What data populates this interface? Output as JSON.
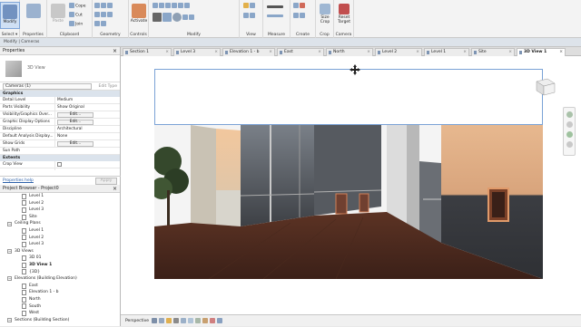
{
  "ribbon": {
    "groups": [
      {
        "label": "Select ▾"
      },
      {
        "label": "Properties"
      },
      {
        "label": "Clipboard"
      },
      {
        "label": "Geometry"
      },
      {
        "label": "Controls"
      },
      {
        "label": "Modify"
      },
      {
        "label": "View"
      },
      {
        "label": "Measure"
      },
      {
        "label": "Create"
      },
      {
        "label": "Crop"
      },
      {
        "label": "Camera"
      }
    ],
    "modify_label": "Modify",
    "paste_label": "Paste",
    "cope_label": "Cope",
    "cut_label": "Cut",
    "join_label": "Join",
    "activate_label": "Activate",
    "size_crop_label": "Size Crop",
    "reset_target_label": "Reset Target"
  },
  "context_bar": {
    "text": "Modify | Cameras"
  },
  "properties": {
    "title": "Properties",
    "type_name": "3D View",
    "filter_value": "Cameras (1)",
    "edit_type_label": "Edit Type",
    "categories": [
      {
        "name": "Graphics",
        "rows": [
          {
            "key": "Detail Level",
            "value": "Medium"
          },
          {
            "key": "Parts Visibility",
            "value": "Show Original"
          },
          {
            "key": "Visibility/Graphics Over...",
            "value": "Edit...",
            "button": true
          },
          {
            "key": "Graphic Display Options",
            "value": "Edit...",
            "button": true
          },
          {
            "key": "Discipline",
            "value": "Architectural"
          },
          {
            "key": "Default Analysis Display...",
            "value": "None"
          },
          {
            "key": "Show Grids",
            "value": "Edit...",
            "button": true
          },
          {
            "key": "Sun Path",
            "value": ""
          }
        ]
      },
      {
        "name": "Extents",
        "rows": [
          {
            "key": "Crop View",
            "value": ""
          }
        ]
      }
    ],
    "help_link": "Properties help",
    "apply_label": "Apply"
  },
  "project_browser": {
    "title": "Project Browser - Project0",
    "nodes": [
      {
        "label": "Level 1",
        "depth": 2,
        "kind": "page"
      },
      {
        "label": "Level 2",
        "depth": 2,
        "kind": "page"
      },
      {
        "label": "Level 3",
        "depth": 2,
        "kind": "page"
      },
      {
        "label": "Site",
        "depth": 2,
        "kind": "page"
      },
      {
        "label": "Ceiling Plans",
        "depth": 1,
        "kind": "toggle"
      },
      {
        "label": "Level 1",
        "depth": 2,
        "kind": "page"
      },
      {
        "label": "Level 2",
        "depth": 2,
        "kind": "page"
      },
      {
        "label": "Level 3",
        "depth": 2,
        "kind": "page"
      },
      {
        "label": "3D Views",
        "depth": 1,
        "kind": "toggle"
      },
      {
        "label": "3D 01",
        "depth": 2,
        "kind": "page"
      },
      {
        "label": "3D View 1",
        "depth": 2,
        "kind": "page",
        "selected": true
      },
      {
        "label": "{3D}",
        "depth": 2,
        "kind": "page"
      },
      {
        "label": "Elevations (Building Elevation)",
        "depth": 1,
        "kind": "toggle"
      },
      {
        "label": "East",
        "depth": 2,
        "kind": "page"
      },
      {
        "label": "Elevation 1 - b",
        "depth": 2,
        "kind": "page"
      },
      {
        "label": "North",
        "depth": 2,
        "kind": "page"
      },
      {
        "label": "South",
        "depth": 2,
        "kind": "page"
      },
      {
        "label": "West",
        "depth": 2,
        "kind": "page"
      },
      {
        "label": "Sections (Building Section)",
        "depth": 1,
        "kind": "toggle"
      }
    ]
  },
  "view_tabs": [
    {
      "label": "Section 1"
    },
    {
      "label": "Level 3"
    },
    {
      "label": "Elevation 1 - b"
    },
    {
      "label": "East"
    },
    {
      "label": "North"
    },
    {
      "label": "Level 2"
    },
    {
      "label": "Level 1"
    },
    {
      "label": "Site"
    },
    {
      "label": "3D View 1",
      "active": true
    }
  ],
  "status_bar": {
    "view_mode": "Perspective"
  },
  "colors": {
    "accent": "#2b5fa8",
    "crop_border": "#7aa2d6",
    "floor": "#4a2a1e",
    "wall_dark": "#3a3a3e",
    "sky_warm": "#e8b48a"
  },
  "icons": [
    "modify-icon",
    "properties-icon",
    "paste-icon",
    "cope-icon",
    "cut-icon",
    "join-icon",
    "activate-icon",
    "move-icon",
    "rotate-icon",
    "measure-icon",
    "size-crop-icon",
    "reset-target-icon",
    "close-icon",
    "view-cube-icon",
    "navigation-wheel-icon"
  ]
}
